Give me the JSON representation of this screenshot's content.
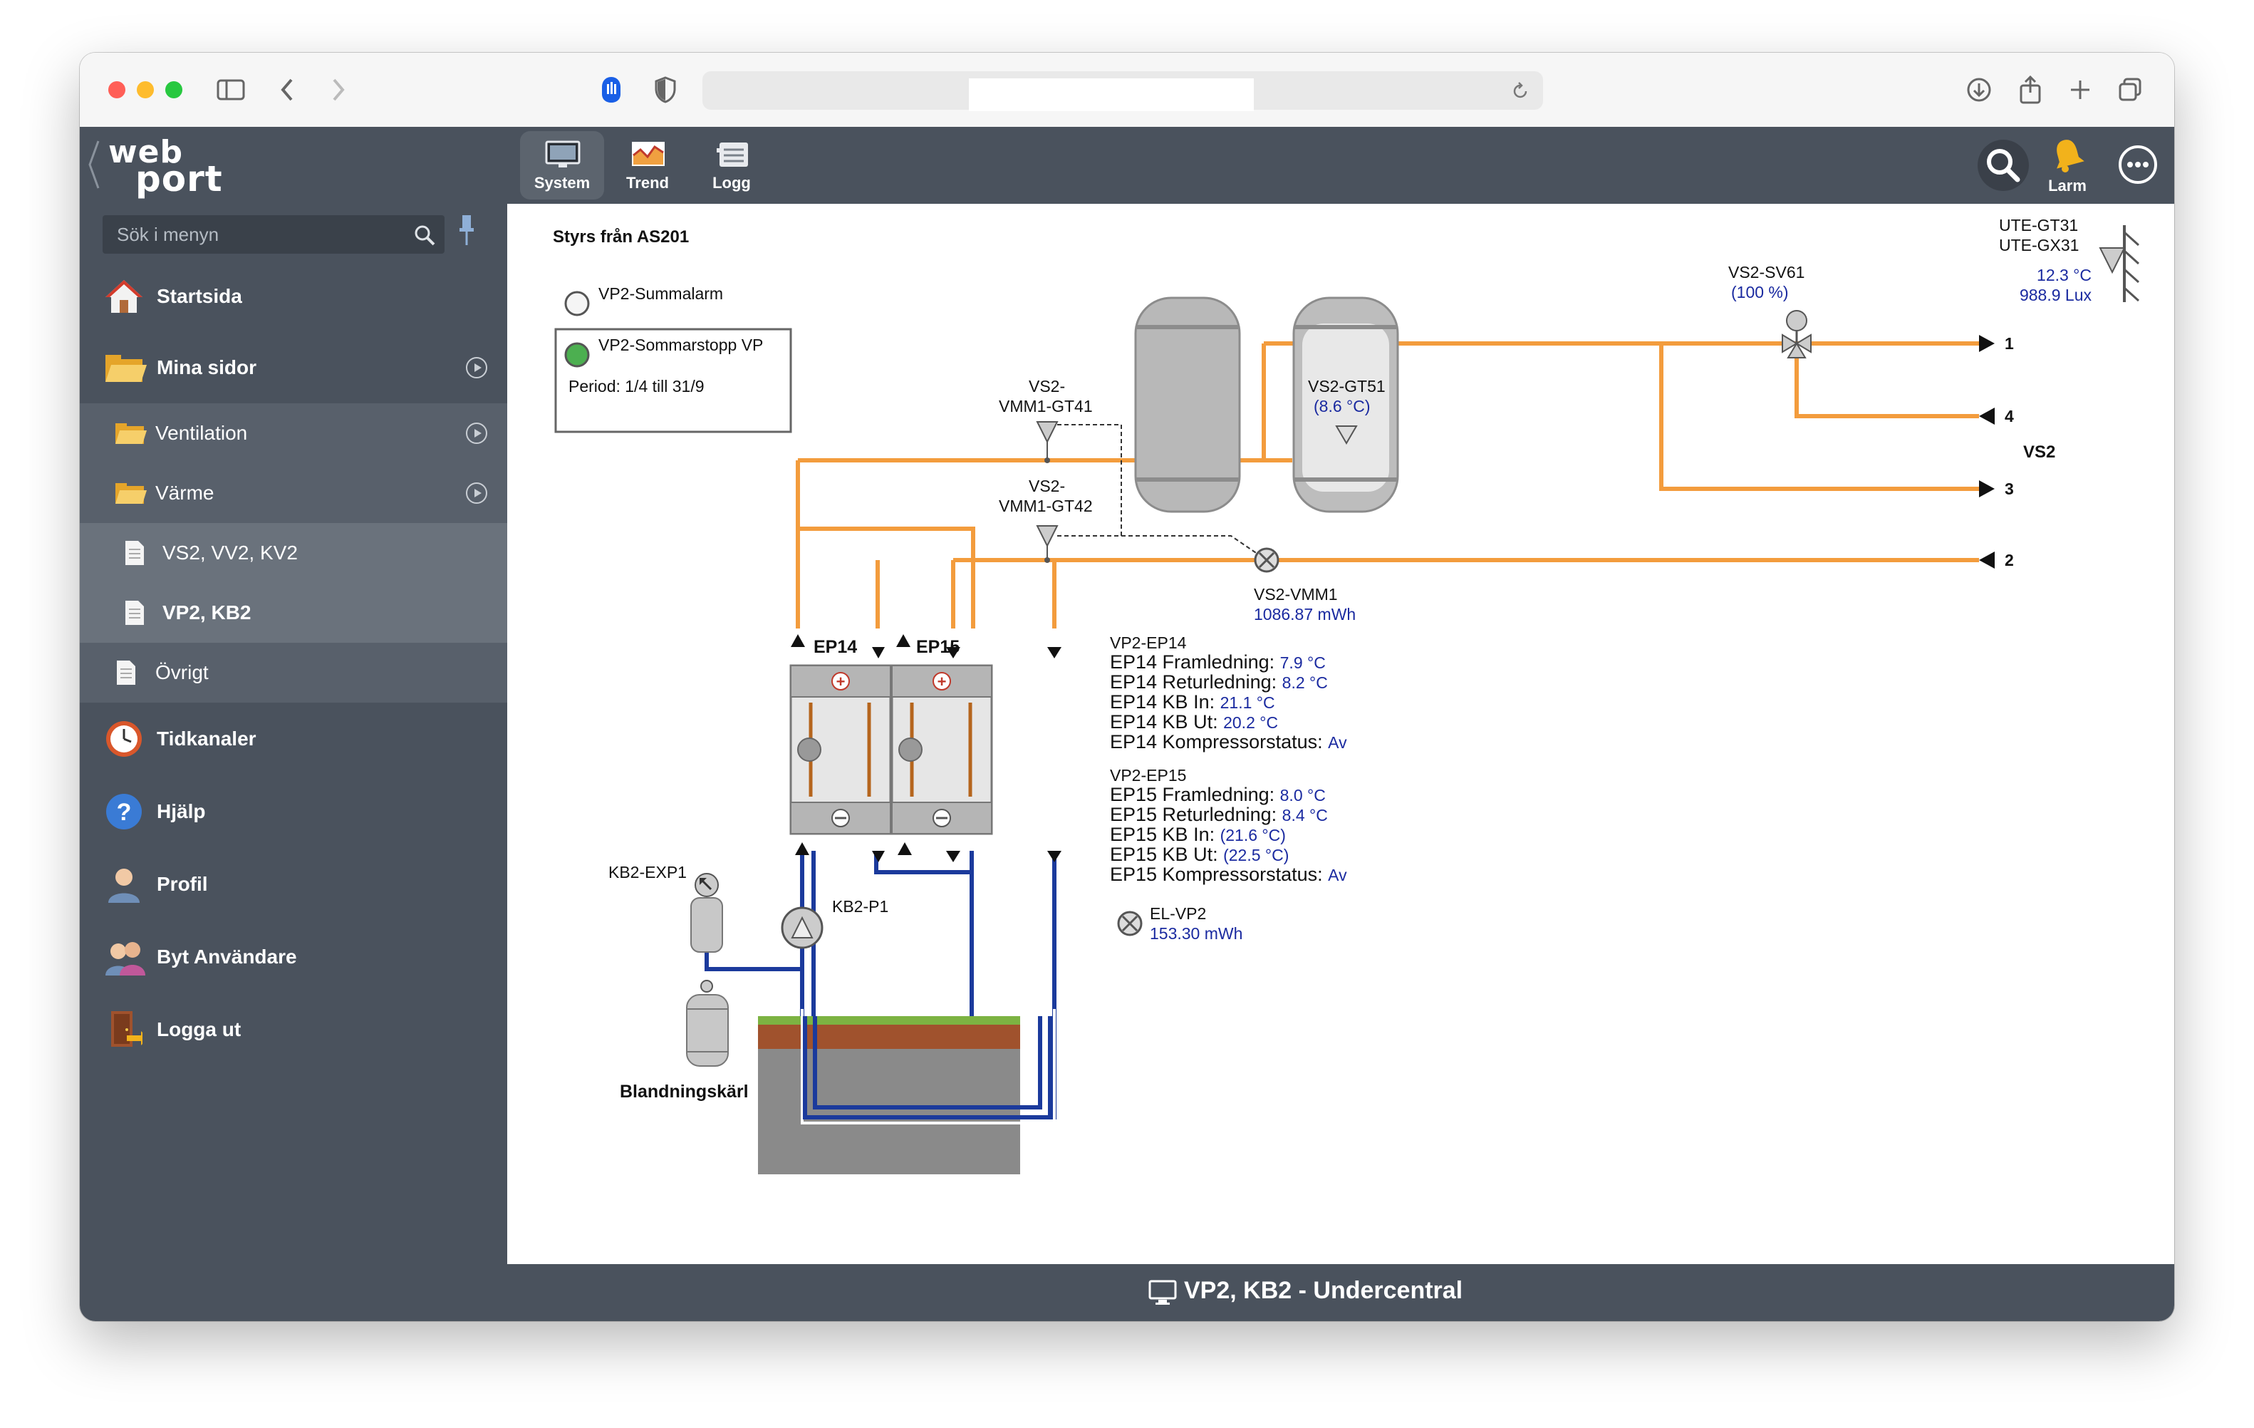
{
  "header": {
    "logo_line1": "web",
    "logo_line2": "port",
    "nav": [
      {
        "label": "System"
      },
      {
        "label": "Trend"
      },
      {
        "label": "Logg"
      }
    ],
    "alarm_label": "Larm"
  },
  "sidebar": {
    "search_placeholder": "Sök i menyn",
    "items": [
      {
        "label": "Startsida"
      },
      {
        "label": "Mina sidor"
      },
      {
        "label": "Ventilation"
      },
      {
        "label": "Värme"
      },
      {
        "label": "VS2, VV2, KV2"
      },
      {
        "label": "VP2, KB2"
      },
      {
        "label": "Övrigt"
      },
      {
        "label": "Tidkanaler"
      },
      {
        "label": "Hjälp"
      },
      {
        "label": "Profil"
      },
      {
        "label": "Byt Användare"
      },
      {
        "label": "Logga ut"
      }
    ]
  },
  "diagram": {
    "title": "Styrs från AS201",
    "summalarm": "VP2-Summalarm",
    "sommarstopp": "VP2-Sommarstopp VP",
    "period": "Period: 1/4 till 31/9",
    "ute_gt31": "UTE-GT31",
    "ute_gx31": "UTE-GX31",
    "ute_temp": "12.3 °C",
    "ute_lux": "988.9 Lux",
    "sv61_name": "VS2-SV61",
    "sv61_value": "(100 %)",
    "gt41_line1": "VS2-",
    "gt41_line2": "VMM1-GT41",
    "gt42_line1": "VS2-",
    "gt42_line2": "VMM1-GT42",
    "gt51_name": "VS2-GT51",
    "gt51_value": "(8.6 °C)",
    "vmm1_name": "VS2-VMM1",
    "vmm1_value": "1086.87 mWh",
    "port1": "1",
    "port4": "4",
    "port3": "3",
    "port2": "2",
    "vs2": "VS2",
    "ep14": "EP14",
    "ep15": "EP15",
    "ep14_block": {
      "title": "VP2-EP14",
      "rows": [
        {
          "label": "EP14 Framledning:",
          "value": "7.9 °C"
        },
        {
          "label": "EP14 Returledning:",
          "value": "8.2 °C"
        },
        {
          "label": "EP14 KB In:",
          "value": "21.1 °C"
        },
        {
          "label": "EP14 KB Ut:",
          "value": "20.2 °C"
        },
        {
          "label": "EP14 Kompressorstatus:",
          "value": "Av"
        }
      ]
    },
    "ep15_block": {
      "title": "VP2-EP15",
      "rows": [
        {
          "label": "EP15 Framledning:",
          "value": "8.0 °C"
        },
        {
          "label": "EP15 Returledning:",
          "value": "8.4 °C"
        },
        {
          "label": "EP15 KB In:",
          "value": "(21.6 °C)"
        },
        {
          "label": "EP15 KB Ut:",
          "value": "(22.5 °C)"
        },
        {
          "label": "EP15 Kompressorstatus:",
          "value": "Av"
        }
      ]
    },
    "el_vp2_name": "EL-VP2",
    "el_vp2_value": "153.30 mWh",
    "kb2_exp1": "KB2-EXP1",
    "kb2_p1": "KB2-P1",
    "blandningskarl": "Blandningskärl"
  },
  "footer": {
    "title": "VP2, KB2 - Undercentral"
  },
  "colors": {
    "pipe_warm": "#f39c3d",
    "pipe_cold": "#1b3a9c",
    "sidebar_bg": "#4a525d",
    "value_text": "#1a2aa0"
  }
}
